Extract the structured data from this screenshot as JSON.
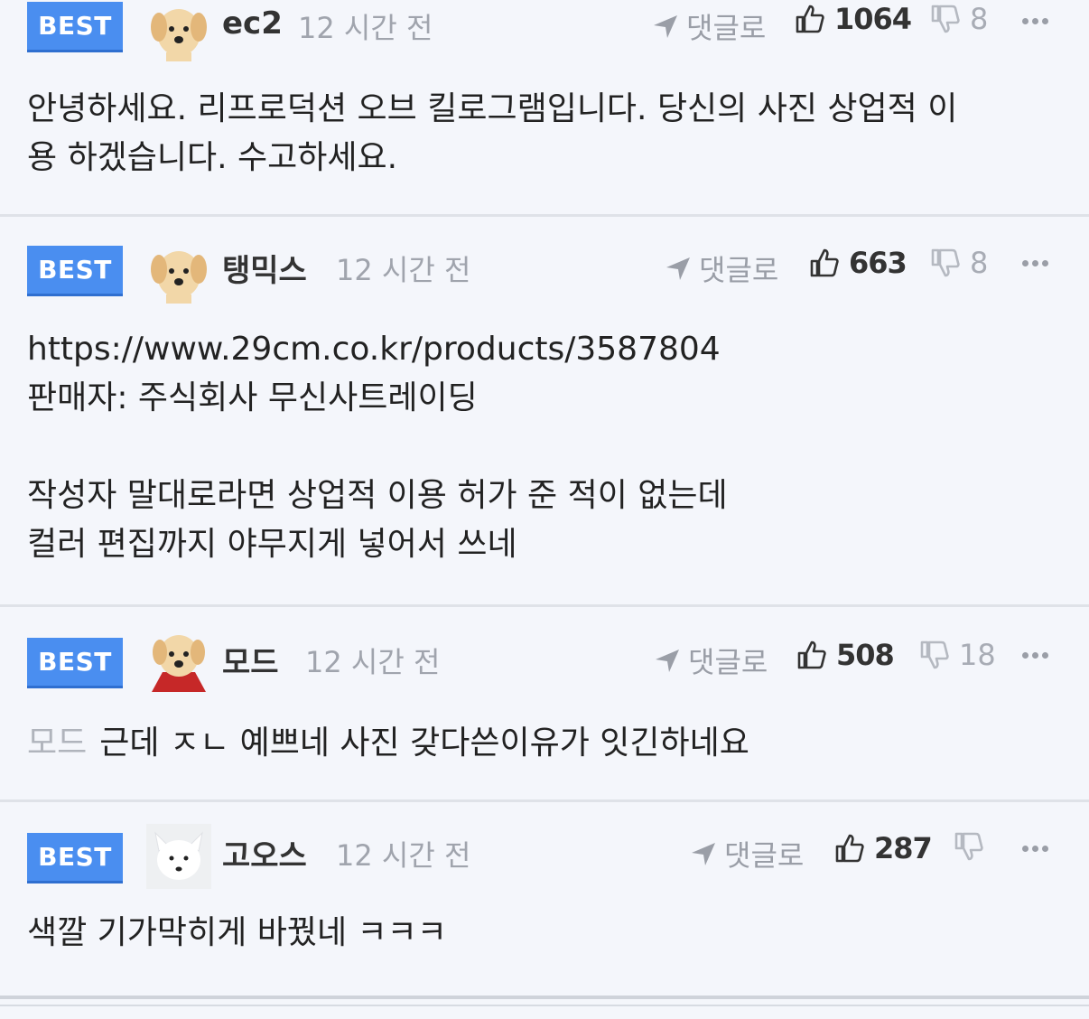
{
  "comments": [
    {
      "badge": "BEST",
      "author": "ec2",
      "time": "12 시간 전",
      "reply_label": "댓글로",
      "likes": "1064",
      "dislikes": "8",
      "avatar": "puppy-avatar",
      "lines": [
        "안녕하세요. 리프로덕션 오브 킬로그램입니다. 당신의 사진 상업적 이",
        "용 하겠습니다. 수고하세요."
      ]
    },
    {
      "badge": "BEST",
      "author": "탱믹스",
      "time": "12 시간 전",
      "reply_label": "댓글로",
      "likes": "663",
      "dislikes": "8",
      "avatar": "puppy-avatar",
      "lines": [
        "https://www.29cm.co.kr/products/3587804",
        "판매자: 주식회사 무신사트레이딩",
        "",
        "작성자 말대로라면 상업적 이용 허가 준 적이 없는데",
        "컬러 편집까지 야무지게 넣어서 쓰네"
      ]
    },
    {
      "badge": "BEST",
      "author": "모드",
      "time": "12 시간 전",
      "reply_label": "댓글로",
      "likes": "508",
      "dislikes": "18",
      "avatar": "puppy-with-red-cape-avatar",
      "mention": "모드",
      "lines": [
        "근데 ㅈㄴ 예쁘네 사진 갖다쓴이유가 잇긴하네요"
      ]
    },
    {
      "badge": "BEST",
      "author": "고오스",
      "time": "12 시간 전",
      "reply_label": "댓글로",
      "likes": "287",
      "dislikes": "",
      "avatar": "white-fox-avatar",
      "lines": [
        "색깔 기가막히게 바꿨네 ㅋㅋㅋ"
      ]
    }
  ],
  "colors": {
    "background": "#f4f6fb",
    "best_badge": "#4a8ef0",
    "muted_text": "#a0a4ad",
    "divider": "#dfe2e8"
  },
  "icons": [
    "send-arrow-icon",
    "thumbs-up-icon",
    "thumbs-down-icon",
    "more-options-icon"
  ]
}
